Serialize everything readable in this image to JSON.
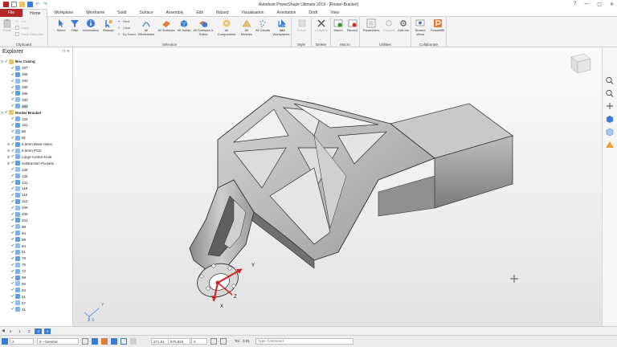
{
  "window": {
    "title": "Autodesk PowerShape Ultimate 2019 - [Router-Bracket]",
    "controls": [
      "—",
      "▢",
      "✕",
      "?"
    ]
  },
  "menu": {
    "tabs": [
      "File",
      "Home",
      "Workplane",
      "Wireframe",
      "Solid",
      "Surface",
      "Assembly",
      "Edit",
      "Wizard",
      "Visualisation",
      "Annotation",
      "Draft",
      "View"
    ]
  },
  "ribbon": {
    "clipboard": {
      "label": "Clipboard",
      "paste": "Paste",
      "cut": "Cut",
      "copy": "Copy",
      "paste_special": "Paste Attributes"
    },
    "selection": {
      "label": "Selection",
      "select": "Select",
      "filter": "Filter",
      "information": "Information",
      "restore": "Restore",
      "next": "Next",
      "clear": "Clear",
      "by_name": "By Name",
      "buttons": [
        "All Wireframes",
        "All Surfaces",
        "All Solids",
        "All Surfaces & Solids",
        "All Components",
        "All Meshes",
        "All Clouds",
        "All Workplanes",
        "All"
      ]
    },
    "style": {
      "label": "Style",
      "colour": "Colour"
    },
    "delete": {
      "label": "Delete",
      "delete": "Delete",
      "undelete": "Undelete"
    },
    "macro": {
      "label": "Macro",
      "macro": "Macro",
      "record": "Record"
    },
    "utilities": {
      "label": "Utilities",
      "parameters": "Parameters",
      "convert": "Convert",
      "addins": "Add-Ins"
    },
    "collaborate": {
      "label": "Collaborate",
      "shared_views": "Shared Views",
      "powermill": "PowerMill"
    }
  },
  "explorer": {
    "title": "Explorer",
    "groups": [
      {
        "name": "Box Casing",
        "items": [
          "197",
          "195",
          "192",
          "189",
          "186",
          "183",
          "182"
        ]
      },
      {
        "name": "Router Bracket",
        "items": [
          "134",
          "131",
          "85",
          "91",
          "6.5mm Base Holes",
          "6.5mm PCD",
          "Large-Centre-Hole",
          "Subtraction Pockets",
          "128",
          "125",
          "121",
          "118",
          "115",
          "112",
          "109",
          "105",
          "101",
          "98",
          "94",
          "88",
          "84",
          "81",
          "78",
          "75",
          "72",
          "69",
          "66",
          "63",
          "61",
          "57",
          "41"
        ]
      }
    ]
  },
  "viewport": {
    "axis_labels": {
      "x": "X",
      "y": "Y",
      "z": "Z"
    },
    "triad_labels": {
      "x": "X",
      "y": "Y",
      "z": "Z"
    }
  },
  "levels": [
    "0",
    "1",
    "2",
    "3",
    "4"
  ],
  "status": {
    "level_value": "2",
    "level_name": "0 - General",
    "x": "271.01",
    "y": "670.823",
    "z": "0",
    "tol_label": "Tol",
    "tol_value": "0.01",
    "command_placeholder": "Type Command"
  },
  "colors": {
    "file_tab": "#b22828",
    "accent": "#3a7bd5",
    "check": "#2a9a2a"
  }
}
